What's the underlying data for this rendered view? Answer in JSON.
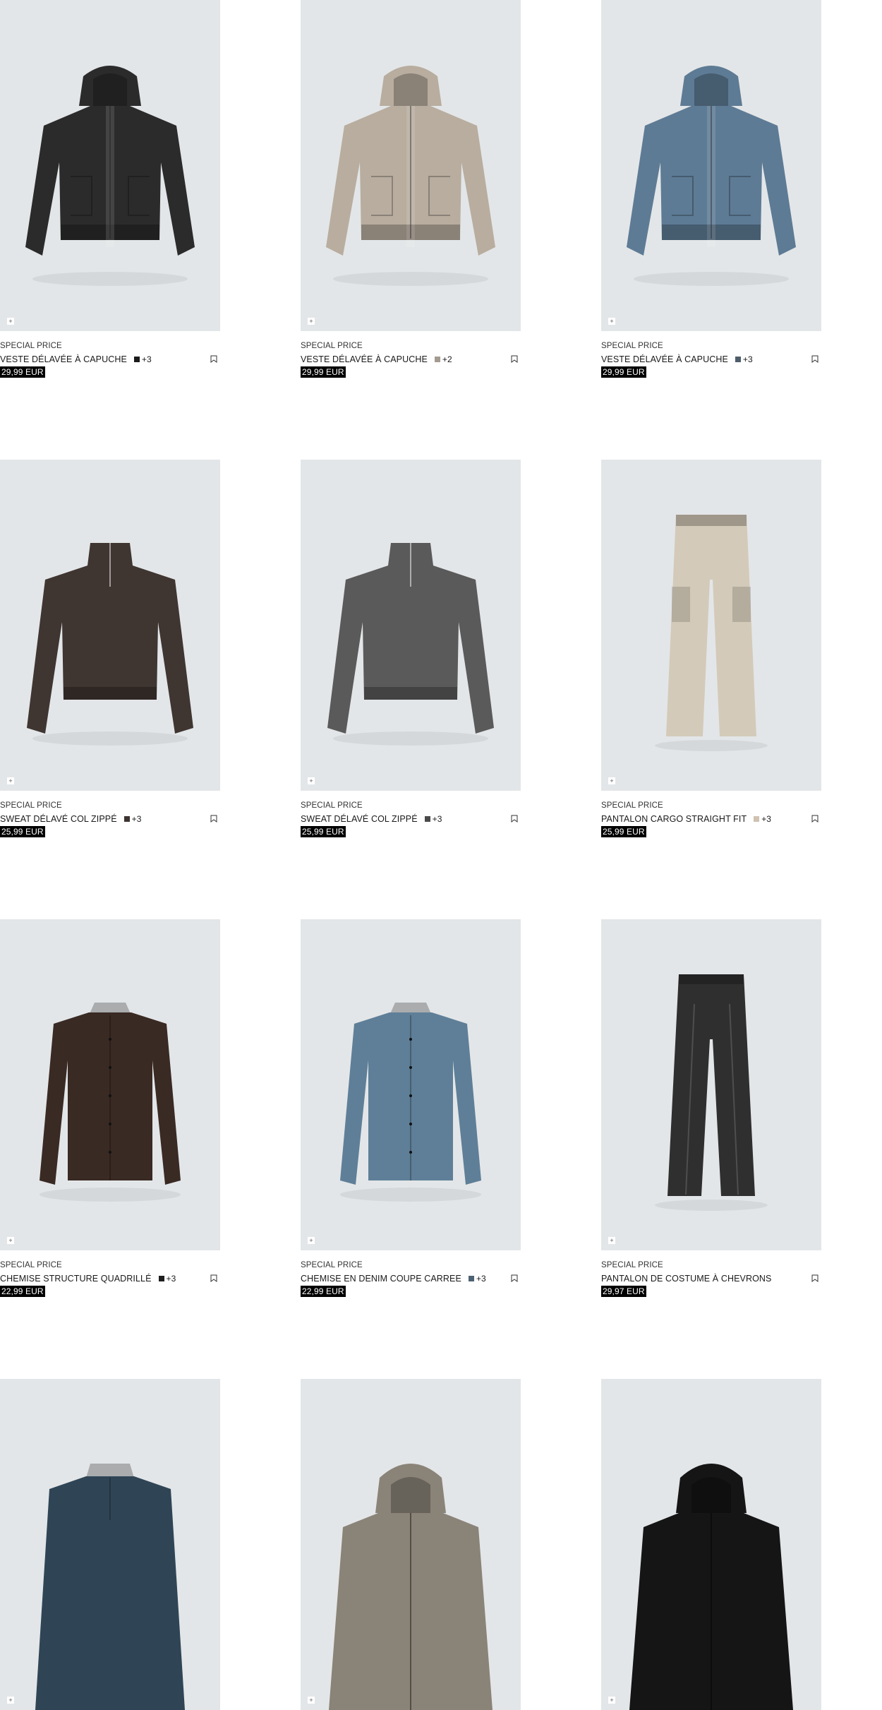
{
  "products": [
    {
      "tag": "SPECIAL PRICE",
      "name": "VESTE DÉLAVÉE À CAPUCHE",
      "swatch": "#1b1b1b",
      "more": "+3",
      "price": "29,99 EUR",
      "garment": "hoodie-jacket",
      "color": "#2b2b2b"
    },
    {
      "tag": "SPECIAL PRICE",
      "name": "VESTE DÉLAVÉE À CAPUCHE",
      "swatch": "#a49b90",
      "more": "+2",
      "price": "29,99 EUR",
      "garment": "hoodie-jacket",
      "color": "#b8ad9f"
    },
    {
      "tag": "SPECIAL PRICE",
      "name": "VESTE DÉLAVÉE À CAPUCHE",
      "swatch": "#4d5d6b",
      "more": "+3",
      "price": "29,99 EUR",
      "garment": "hoodie-jacket",
      "color": "#5e7b95"
    },
    {
      "tag": "SPECIAL PRICE",
      "name": "SWEAT DÉLAVÉ COL ZIPPÉ",
      "swatch": "#3d3431",
      "more": "+3",
      "price": "25,99 EUR",
      "garment": "sweat",
      "color": "#3f3531"
    },
    {
      "tag": "SPECIAL PRICE",
      "name": "SWEAT DÉLAVÉ COL ZIPPÉ",
      "swatch": "#4a4a4a",
      "more": "+3",
      "price": "25,99 EUR",
      "garment": "sweat",
      "color": "#5a5a5a"
    },
    {
      "tag": "SPECIAL PRICE",
      "name": "PANTALON CARGO STRAIGHT FIT",
      "swatch": "#cfc2b1",
      "more": "+3",
      "price": "25,99 EUR",
      "garment": "pants",
      "color": "#d4cab9"
    },
    {
      "tag": "SPECIAL PRICE",
      "name": "CHEMISE STRUCTURE QUADRILLÉ",
      "swatch": "#1e1e1e",
      "more": "+3",
      "price": "22,99 EUR",
      "garment": "shirt",
      "color": "#3a2a24"
    },
    {
      "tag": "SPECIAL PRICE",
      "name": "CHEMISE EN DENIM COUPE CARREE",
      "swatch": "#4d6273",
      "more": "+3",
      "price": "22,99 EUR",
      "garment": "shirt",
      "color": "#5f7f98"
    },
    {
      "tag": "SPECIAL PRICE",
      "name": "PANTALON DE COSTUME À CHEVRONS",
      "swatch": "",
      "more": "",
      "price": "29,97 EUR",
      "garment": "suit-pants",
      "color": "#2f2f2f"
    },
    {
      "tag": "",
      "name": "",
      "swatch": "",
      "more": "",
      "price": "",
      "garment": "polo",
      "color": "#2f4556"
    },
    {
      "tag": "",
      "name": "",
      "swatch": "",
      "more": "",
      "price": "",
      "garment": "hoodie-top",
      "color": "#8a8378"
    },
    {
      "tag": "",
      "name": "",
      "swatch": "",
      "more": "",
      "price": "",
      "garment": "hoodie-top",
      "color": "#151515"
    }
  ],
  "icons": {
    "add": "plus-icon",
    "save": "bookmark-icon"
  },
  "colors": {
    "image_bg": "#e3e6e8",
    "price_bg": "#000000",
    "price_text": "#ffffff"
  }
}
